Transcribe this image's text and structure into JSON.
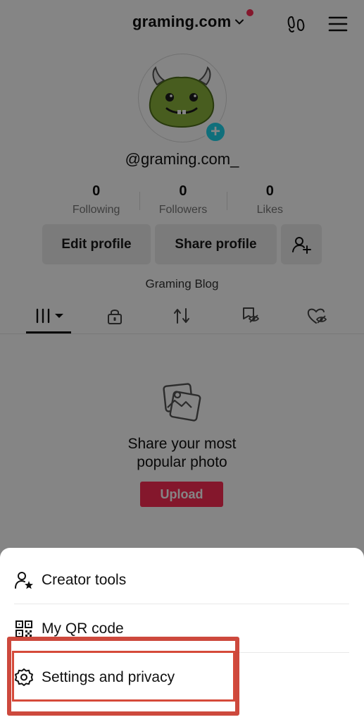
{
  "header": {
    "account_name": "graming.com",
    "has_notification_dot": true
  },
  "profile": {
    "username": "@graming.com_",
    "bio": "Graming Blog",
    "add_badge": "+"
  },
  "stats": [
    {
      "value": "0",
      "label": "Following"
    },
    {
      "value": "0",
      "label": "Followers"
    },
    {
      "value": "0",
      "label": "Likes"
    }
  ],
  "actions": {
    "edit_profile": "Edit profile",
    "share_profile": "Share profile"
  },
  "tabs": [
    {
      "icon": "grid-icon",
      "active": true
    },
    {
      "icon": "lock-icon",
      "active": false
    },
    {
      "icon": "repost-icon",
      "active": false
    },
    {
      "icon": "hidden-favorites-icon",
      "active": false
    },
    {
      "icon": "hidden-likes-icon",
      "active": false
    }
  ],
  "empty_state": {
    "title_line1": "Share your most",
    "title_line2": "popular photo",
    "button": "Upload"
  },
  "sheet": {
    "items": [
      {
        "label": "Creator tools",
        "icon": "creator-tools-icon"
      },
      {
        "label": "My QR code",
        "icon": "qr-code-icon"
      },
      {
        "label": "Settings and privacy",
        "icon": "gear-icon"
      }
    ]
  },
  "colors": {
    "accent": "#fe2c55",
    "avatar_add": "#20d5ec",
    "annotation": "#c93a2c"
  }
}
